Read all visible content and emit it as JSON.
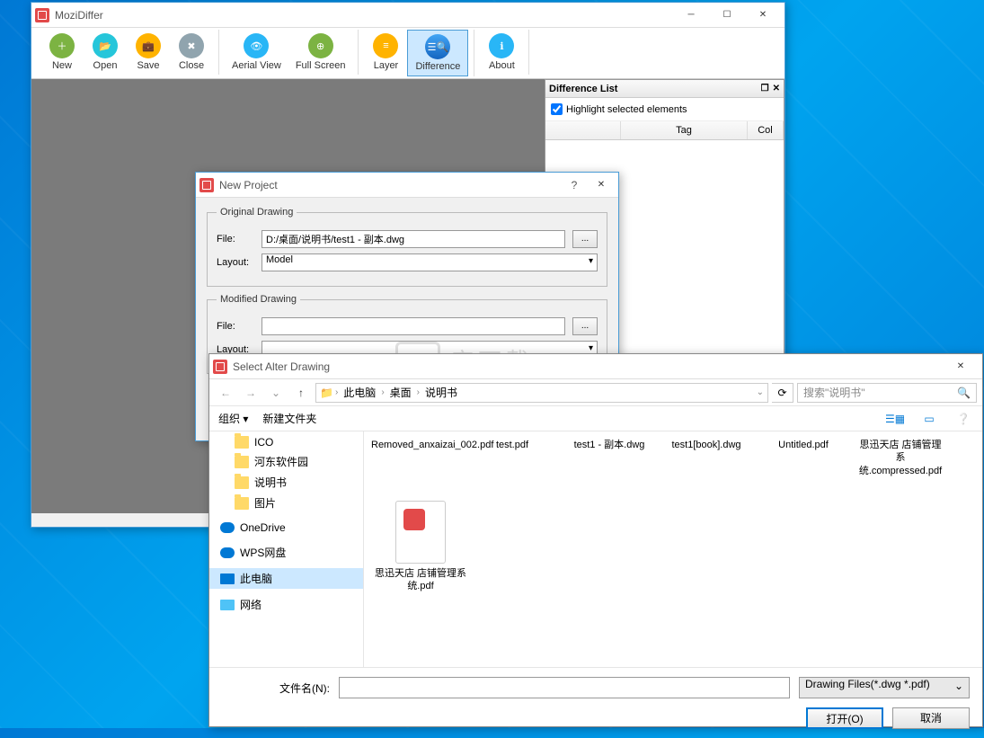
{
  "main": {
    "title": "MoziDiffer",
    "toolbar": [
      {
        "name": "new",
        "label": "New",
        "color": "bg-green",
        "group": 0
      },
      {
        "name": "open",
        "label": "Open",
        "color": "bg-teal",
        "group": 0
      },
      {
        "name": "save",
        "label": "Save",
        "color": "bg-amber",
        "group": 0
      },
      {
        "name": "close",
        "label": "Close",
        "color": "bg-grey",
        "group": 0
      },
      {
        "name": "aerial",
        "label": "Aerial View",
        "color": "bg-blue",
        "group": 1
      },
      {
        "name": "fullscreen",
        "label": "Full Screen",
        "color": "bg-green",
        "group": 1
      },
      {
        "name": "layer",
        "label": "Layer",
        "color": "bg-amber",
        "group": 2
      },
      {
        "name": "difference",
        "label": "Difference",
        "color": "bg-navy",
        "group": 2,
        "active": true
      },
      {
        "name": "about",
        "label": "About",
        "color": "bg-blue",
        "group": 3
      }
    ],
    "diffPanel": {
      "title": "Difference List",
      "checkbox": "Highlight selected elements",
      "columns": [
        "",
        "Tag",
        "Col"
      ]
    }
  },
  "newProject": {
    "title": "New Project",
    "original": {
      "legend": "Original Drawing",
      "fileLabel": "File:",
      "fileValue": "D:/桌面/说明书/test1 - 副本.dwg",
      "layoutLabel": "Layout:",
      "layoutValue": "Model",
      "browse": "..."
    },
    "modified": {
      "legend": "Modified Drawing",
      "fileLabel": "File:",
      "fileValue": "",
      "layoutLabel": "Layout:",
      "layoutValue": "",
      "browse": "..."
    }
  },
  "fileDialog": {
    "title": "Select Alter Drawing",
    "breadcrumb": [
      "此电脑",
      "桌面",
      "说明书"
    ],
    "searchPlaceholder": "搜索\"说明书\"",
    "organize": "组织 ▾",
    "newFolder": "新建文件夹",
    "tree": [
      {
        "label": "ICO",
        "icon": "folder"
      },
      {
        "label": "河东软件园",
        "icon": "folder"
      },
      {
        "label": "说明书",
        "icon": "folder"
      },
      {
        "label": "图片",
        "icon": "folder"
      },
      {
        "label": "OneDrive",
        "icon": "cloud"
      },
      {
        "label": "WPS网盘",
        "icon": "cloud"
      },
      {
        "label": "此电脑",
        "icon": "pc",
        "selected": true
      },
      {
        "label": "网络",
        "icon": "net"
      }
    ],
    "files": [
      "Removed_anxaizai_002.pdf",
      "test.pdf",
      "test1 - 副本.dwg",
      "test1[book].dwg",
      "Untitled.pdf",
      "思迅天店 店铺管理系统.compressed.pdf"
    ],
    "bigfile": "思迅天店 店铺管理系统.pdf",
    "filenameLabel": "文件名(N):",
    "filenameValue": "",
    "filter": "Drawing Files(*.dwg *.pdf)",
    "openBtn": "打开(O)",
    "cancelBtn": "取消"
  },
  "watermark": "安下载 anxz.com"
}
